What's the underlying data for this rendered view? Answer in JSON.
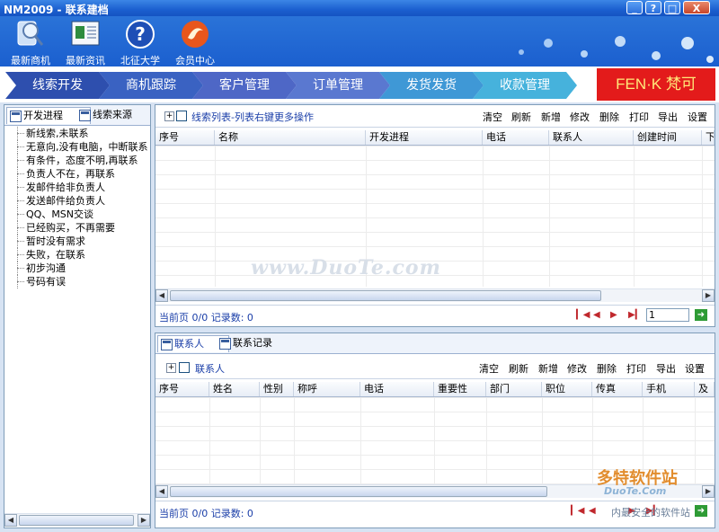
{
  "window": {
    "title": "NM2009 - 联系建档",
    "controls": [
      "_",
      "?",
      "□",
      "X"
    ]
  },
  "toolbar": [
    {
      "label": "最新商机",
      "icon": "search-people-icon"
    },
    {
      "label": "最新资讯",
      "icon": "news-screen-icon"
    },
    {
      "label": "北征大学",
      "icon": "help-question-icon"
    },
    {
      "label": "会员中心",
      "icon": "member-logo-icon"
    }
  ],
  "menu": [
    {
      "label": "线索开发",
      "color": "#2e4fae"
    },
    {
      "label": "商机跟踪",
      "color": "#3a62c2"
    },
    {
      "label": "客户管理",
      "color": "#4e67c6"
    },
    {
      "label": "订单管理",
      "color": "#5a78d0"
    },
    {
      "label": "发货发货",
      "color": "#3f98d6"
    },
    {
      "label": "收款管理",
      "color": "#46b2dc"
    }
  ],
  "brand": "FEN·K 梵可",
  "left": {
    "tabs": [
      "开发进程",
      "线索来源"
    ],
    "items": [
      "新线索,未联系",
      "无意向,没有电脑，中断联系",
      "有条件，态度不明,再联系",
      "负责人不在，再联系",
      "发邮件给非负责人",
      "发送邮件给负责人",
      "QQ、MSN交谈",
      "已经购买，不再需要",
      "暂时没有需求",
      "失败，在联系",
      "初步沟通",
      "号码有误"
    ]
  },
  "top": {
    "label": "线索列表-列表右键更多操作",
    "actions": [
      "清空",
      "刷新",
      "新增",
      "修改",
      "删除",
      "打印",
      "导出",
      "设置"
    ],
    "columns": [
      "序号",
      "名称",
      "开发进程",
      "电话",
      "联系人",
      "创建时间",
      "下"
    ],
    "pager_info": "当前页 0/0 记录数: 0",
    "page_value": "1"
  },
  "bottom": {
    "tabs": [
      "联系人",
      "联系记录"
    ],
    "label": "联系人",
    "actions": [
      "清空",
      "刷新",
      "新增",
      "修改",
      "删除",
      "打印",
      "导出",
      "设置"
    ],
    "columns": [
      "序号",
      "姓名",
      "性别",
      "称呼",
      "电话",
      "重要性",
      "部门",
      "职位",
      "传真",
      "手机",
      "及"
    ],
    "pager_info": "当前页 0/0 记录数: 0"
  },
  "watermark": {
    "main": "www.DuoTe.com",
    "logo": "多特软件站",
    "logo_sub": "DuoTe.Com",
    "tail": "内最安全的软件站"
  }
}
